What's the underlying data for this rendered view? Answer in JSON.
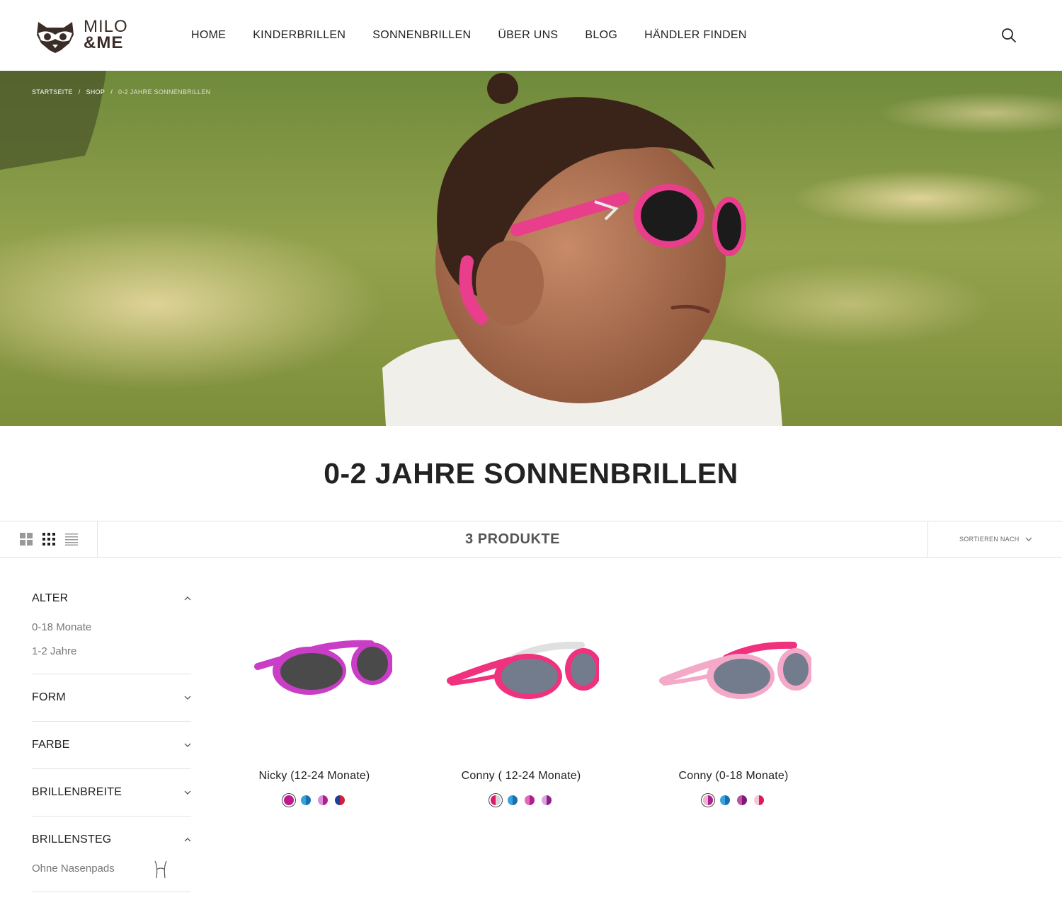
{
  "brand": {
    "line1": "MILO",
    "line2": "&ME"
  },
  "nav": {
    "items": [
      "HOME",
      "KINDERBRILLEN",
      "SONNENBRILLEN",
      "ÜBER UNS",
      "BLOG",
      "HÄNDLER FINDEN"
    ]
  },
  "icons": {
    "search": "search-icon",
    "grid_large": "grid-large-icon",
    "grid_small": "grid-small-icon",
    "list": "list-icon"
  },
  "breadcrumb": {
    "home": "STARTSEITE",
    "sep": "/",
    "shop": "SHOP",
    "current": "0-2 JAHRE SONNENBRILLEN"
  },
  "page": {
    "title": "0-2 JAHRE SONNENBRILLEN"
  },
  "toolbar": {
    "count": "3 PRODUKTE",
    "sort_label": "SORTIEREN NACH"
  },
  "filters": {
    "alter": {
      "title": "ALTER",
      "options": [
        "0-18 Monate",
        "1-2 Jahre"
      ]
    },
    "form": {
      "title": "FORM"
    },
    "farbe": {
      "title": "FARBE"
    },
    "brillenbreite": {
      "title": "BRILLENBREITE"
    },
    "brillensteg": {
      "title": "BRILLENSTEG",
      "options": [
        "Ohne Nasenpads"
      ]
    }
  },
  "products": [
    {
      "name": "Nicky (12-24 Monate)"
    },
    {
      "name": "Conny ( 12-24 Monate)"
    },
    {
      "name": "Conny (0-18 Monate)"
    }
  ],
  "colors": {
    "accent_pink": "#e83e8c",
    "text": "#222222",
    "muted": "#777777",
    "border": "#e3e3e3"
  }
}
